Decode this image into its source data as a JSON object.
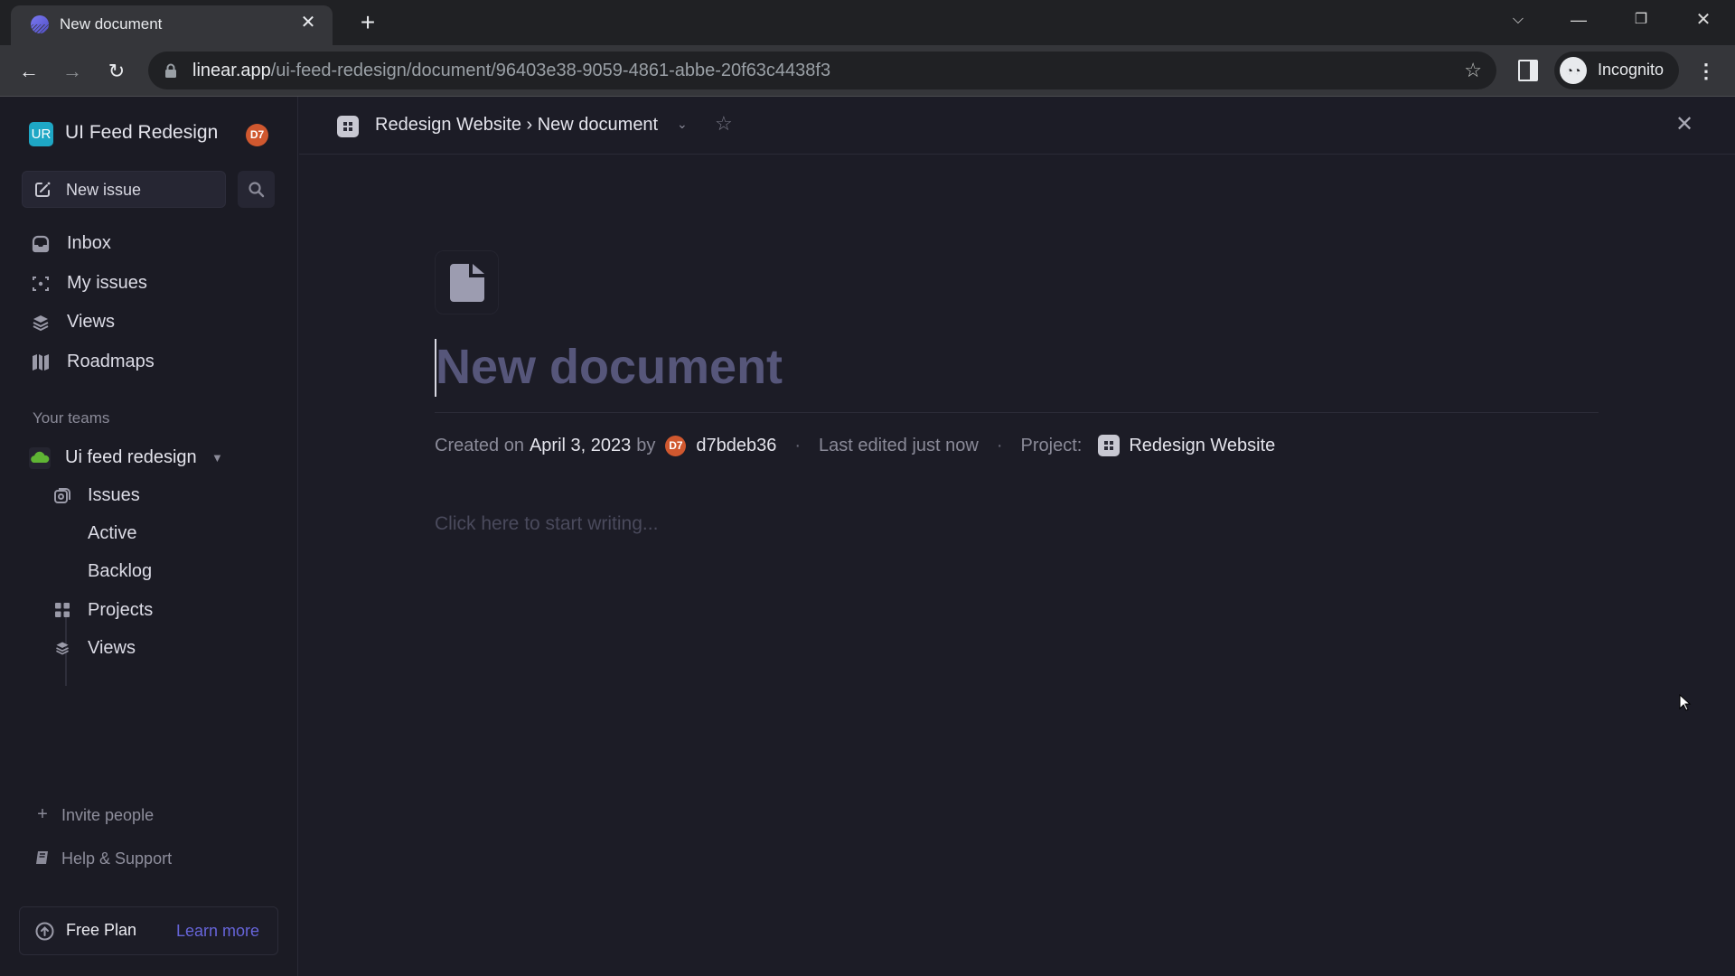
{
  "browser": {
    "tab_title": "New document",
    "new_tab_icon": "plus-icon",
    "url_host": "linear.app",
    "url_path": "/ui-feed-redesign/document/96403e38-9059-4861-abbe-20f63c4438f3",
    "profile_label": "Incognito",
    "window_controls": [
      "tab-search",
      "minimize",
      "restore",
      "close"
    ]
  },
  "sidebar": {
    "workspace_initials": "UR",
    "workspace_name": "UI Feed Redesign",
    "user_initials": "D7",
    "new_issue_label": "New issue",
    "nav": [
      {
        "label": "Inbox",
        "icon": "inbox-icon"
      },
      {
        "label": "My issues",
        "icon": "my-issues-icon"
      },
      {
        "label": "Views",
        "icon": "layers-icon"
      },
      {
        "label": "Roadmaps",
        "icon": "map-icon"
      }
    ],
    "teams_heading": "Your teams",
    "team": {
      "name": "Ui feed redesign",
      "items": [
        {
          "label": "Issues",
          "icon": "issues-icon"
        },
        {
          "label": "Active",
          "icon": ""
        },
        {
          "label": "Backlog",
          "icon": ""
        },
        {
          "label": "Projects",
          "icon": "projects-grid-icon"
        },
        {
          "label": "Views",
          "icon": "layers-icon"
        }
      ]
    },
    "footer": {
      "invite_label": "Invite people",
      "help_label": "Help & Support",
      "plan_label": "Free Plan",
      "learn_more_label": "Learn more"
    }
  },
  "main": {
    "breadcrumb": "Redesign Website › New document",
    "document": {
      "title_placeholder": "New document",
      "created_prefix": "Created on",
      "created_date": "April 3, 2023",
      "by_label": "by",
      "author_initials": "D7",
      "author": "d7bdeb36",
      "separator": "·",
      "last_edited": "Last edited just now",
      "project_label": "Project:",
      "project_name": "Redesign Website",
      "body_placeholder": "Click here to start writing..."
    }
  },
  "colors": {
    "accent": "#6664d8",
    "workspace_logo": "#1ea7c5",
    "avatar": "#d0582f",
    "team_icon": "#5fb534"
  }
}
